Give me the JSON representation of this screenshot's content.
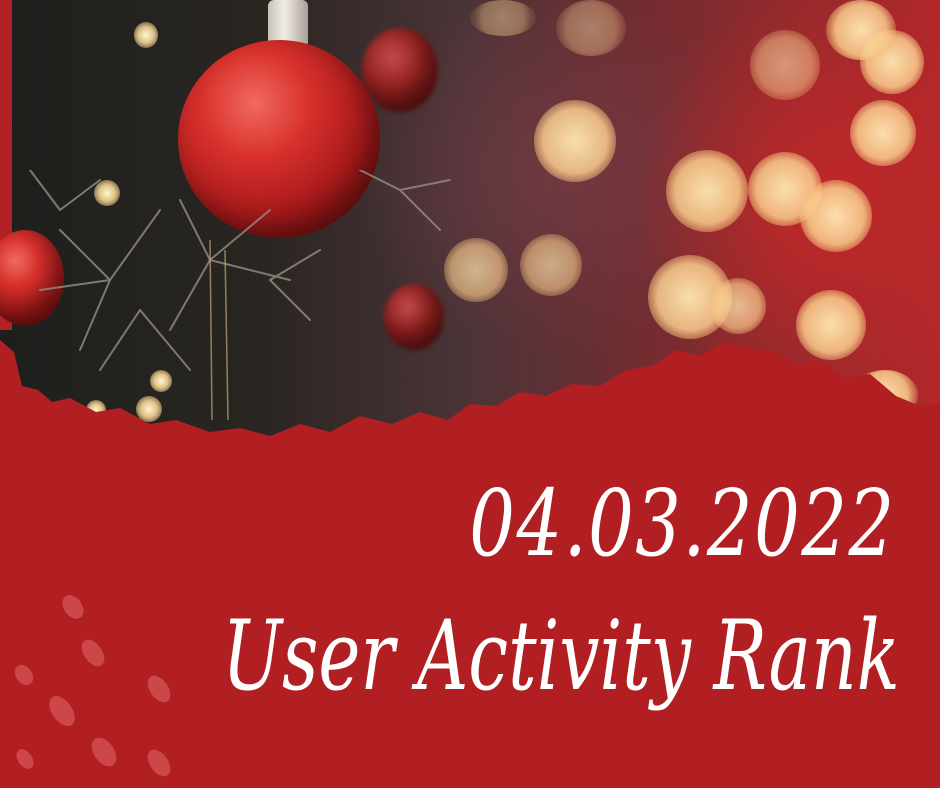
{
  "background": {
    "photo_subject": "red glitter Christmas ornament on a tree with warm bokeh lights",
    "accent_color": "#b21f22",
    "spot_color": "#e87878"
  },
  "text": {
    "date": "04.03.2022",
    "title": "User Activity Rank"
  }
}
